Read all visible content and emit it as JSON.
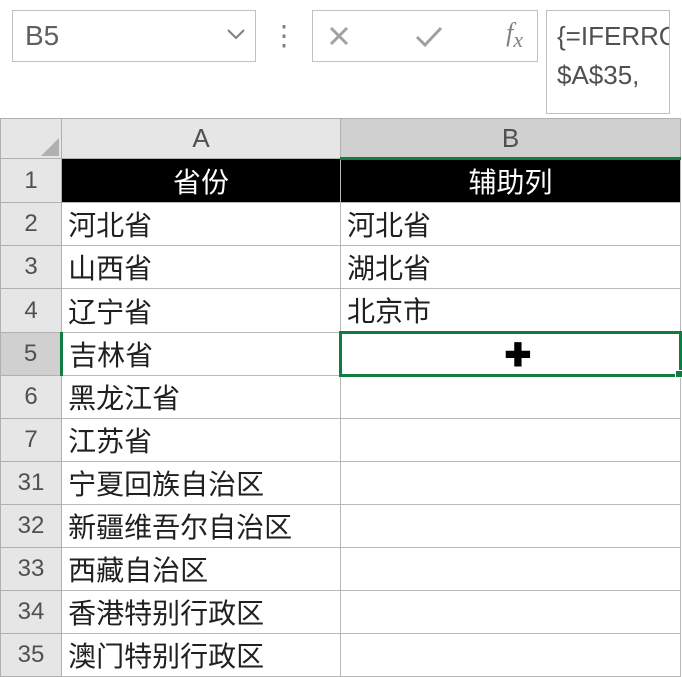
{
  "name_box": "B5",
  "formula_line1": "{=IFERRO",
  "formula_line2": "$A$35, ",
  "columns": {
    "A": "A",
    "B": "B"
  },
  "headers": {
    "A": "省份",
    "B": "辅助列"
  },
  "rows": [
    {
      "n": "1"
    },
    {
      "n": "2",
      "A": "河北省",
      "B": "河北省"
    },
    {
      "n": "3",
      "A": "山西省",
      "B": "湖北省"
    },
    {
      "n": "4",
      "A": "辽宁省",
      "B": "北京市"
    },
    {
      "n": "5",
      "A": "吉林省",
      "B": ""
    },
    {
      "n": "6",
      "A": "黑龙江省",
      "B": ""
    },
    {
      "n": "7",
      "A": "江苏省",
      "B": ""
    },
    {
      "n": "31",
      "A": "宁夏回族自治区",
      "B": ""
    },
    {
      "n": "32",
      "A": "新疆维吾尔自治区",
      "B": ""
    },
    {
      "n": "33",
      "A": "西藏自治区",
      "B": ""
    },
    {
      "n": "34",
      "A": "香港特别行政区",
      "B": ""
    },
    {
      "n": "35",
      "A": "澳门特别行政区",
      "B": ""
    }
  ],
  "cursor": "✚"
}
